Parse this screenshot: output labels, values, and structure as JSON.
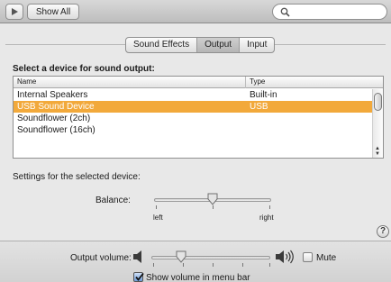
{
  "toolbar": {
    "show_all_label": "Show All",
    "play_icon": "play-triangle-icon",
    "search_icon": "magnifier-icon"
  },
  "tabs": [
    {
      "label": "Sound Effects",
      "active": false
    },
    {
      "label": "Output",
      "active": true
    },
    {
      "label": "Input",
      "active": false
    }
  ],
  "output": {
    "heading": "Select a device for sound output:",
    "columns": {
      "name": "Name",
      "type": "Type"
    },
    "devices": [
      {
        "name": "Internal Speakers",
        "type": "Built-in",
        "selected": false
      },
      {
        "name": "USB Sound Device",
        "type": "USB",
        "selected": true
      },
      {
        "name": "Soundflower (2ch)",
        "type": "",
        "selected": false
      },
      {
        "name": "Soundflower (16ch)",
        "type": "",
        "selected": false
      }
    ],
    "settings_label": "Settings for the selected device:",
    "balance": {
      "label": "Balance:",
      "left_label": "left",
      "right_label": "right",
      "value": 0.5
    }
  },
  "help_label": "?",
  "volume": {
    "label": "Output volume:",
    "value": 0.25,
    "mute_label": "Mute",
    "muted": false,
    "menu_bar_label": "Show volume in menu bar",
    "menu_bar_checked": true
  },
  "colors": {
    "selection": "#f2a93b",
    "toolbar_top": "#d8d8d8",
    "toolbar_bottom": "#bdbdbd",
    "background": "#e8e8e8"
  }
}
